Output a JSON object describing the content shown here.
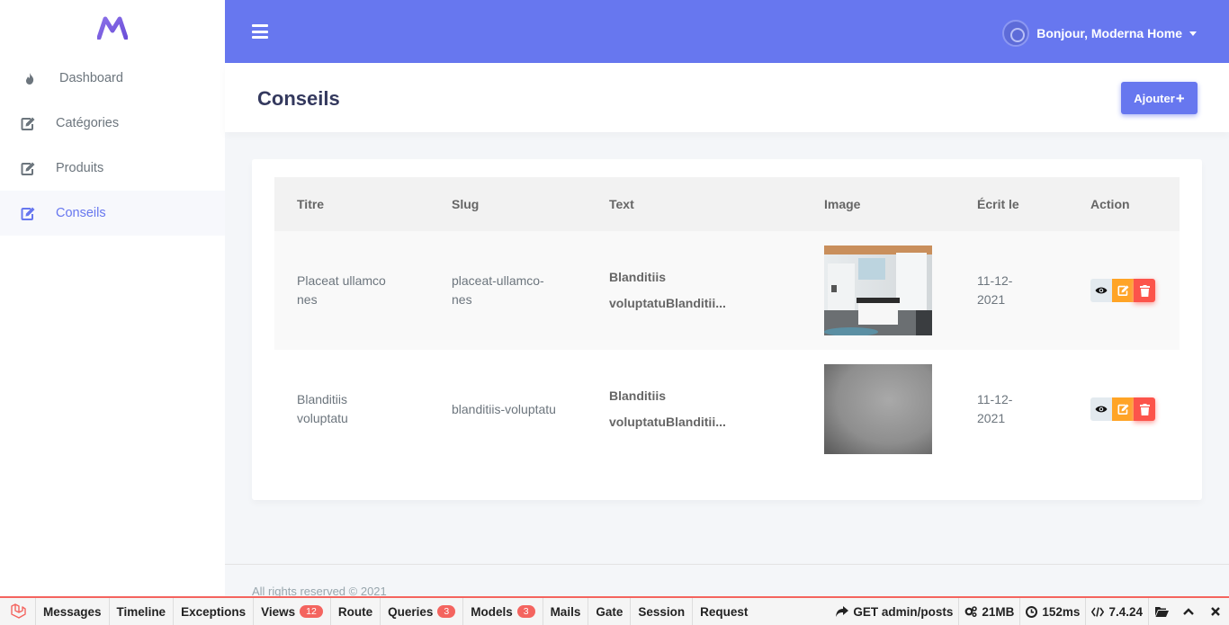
{
  "brand": {
    "accent": "#6777ef",
    "logo_letter": "M"
  },
  "sidebar": {
    "items": [
      {
        "label": "Dashboard",
        "icon": "fire-icon",
        "active": false
      },
      {
        "label": "Catégories",
        "icon": "edit-icon",
        "active": false
      },
      {
        "label": "Produits",
        "icon": "edit-icon",
        "active": false
      },
      {
        "label": "Conseils",
        "icon": "edit-icon",
        "active": true
      }
    ]
  },
  "navbar": {
    "greeting": "Bonjour, Moderna Home"
  },
  "page": {
    "title": "Conseils",
    "add_label": "Ajouter"
  },
  "table": {
    "headers": [
      "Titre",
      "Slug",
      "Text",
      "Image",
      "Écrit le",
      "Action"
    ],
    "rows": [
      {
        "title_l1": "Placeat ullamco",
        "title_l2": "nes",
        "slug_l1": "placeat-ullamco-",
        "slug_l2": "nes",
        "text_l1": "Blanditiis",
        "text_l2": "voluptatuBlanditii...",
        "image": "kitchen-photo",
        "date_l1": "11-12-",
        "date_l2": "2021"
      },
      {
        "title_l1": "Blanditiis",
        "title_l2": "voluptatu",
        "slug_l1": "blanditiis-voluptatu",
        "slug_l2": "",
        "text_l1": "Blanditiis",
        "text_l2": "voluptatuBlanditii...",
        "image": "gray-blurred-photo",
        "date_l1": "11-12-",
        "date_l2": "2021"
      }
    ]
  },
  "footer": {
    "text": "All rights reserved © 2021"
  },
  "debugbar": {
    "tabs": [
      {
        "label": "Messages",
        "badge": ""
      },
      {
        "label": "Timeline",
        "badge": ""
      },
      {
        "label": "Exceptions",
        "badge": ""
      },
      {
        "label": "Views",
        "badge": "12"
      },
      {
        "label": "Route",
        "badge": ""
      },
      {
        "label": "Queries",
        "badge": "3"
      },
      {
        "label": "Models",
        "badge": "3"
      },
      {
        "label": "Mails",
        "badge": ""
      },
      {
        "label": "Gate",
        "badge": ""
      },
      {
        "label": "Session",
        "badge": ""
      },
      {
        "label": "Request",
        "badge": ""
      }
    ],
    "route": "GET admin/posts",
    "memory": "21MB",
    "time": "152ms",
    "php": "7.4.24"
  }
}
